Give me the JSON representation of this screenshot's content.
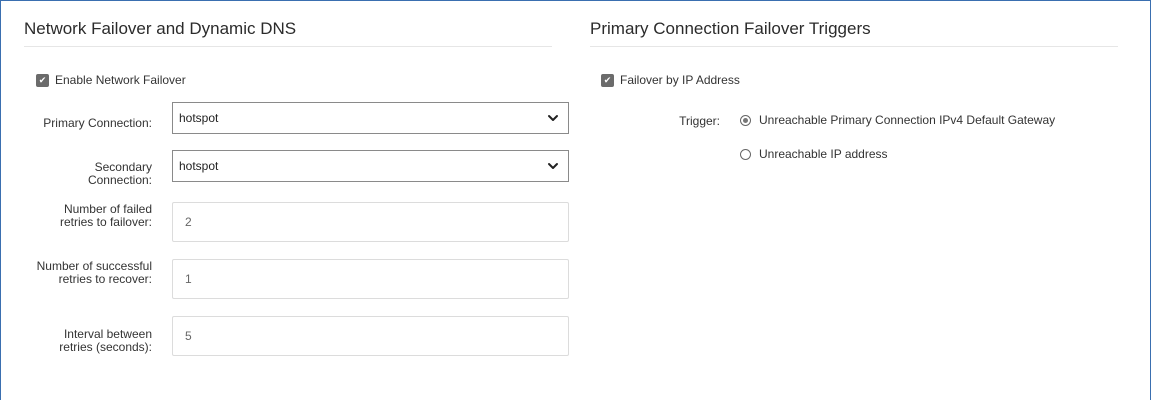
{
  "left_section": {
    "title": "Network Failover and Dynamic DNS",
    "enable_failover": {
      "label": "Enable Network Failover",
      "checked": true
    },
    "primary_connection": {
      "label": "Primary Connection:",
      "value": "hotspot"
    },
    "secondary_connection": {
      "label_line1": "Secondary",
      "label_line2": "Connection:",
      "value": "hotspot"
    },
    "failed_retries": {
      "label_line1": "Number of failed",
      "label_line2": "retries to failover:",
      "value": "2"
    },
    "successful_retries": {
      "label_line1": "Number of successful",
      "label_line2": "retries to recover:",
      "value": "1"
    },
    "interval": {
      "label_line1": "Interval between",
      "label_line2": "retries (seconds):",
      "value": "5"
    }
  },
  "right_section": {
    "title": "Primary Connection Failover Triggers",
    "failover_by_ip": {
      "label": "Failover by IP Address",
      "checked": true
    },
    "trigger": {
      "label": "Trigger:",
      "options": [
        {
          "label": "Unreachable Primary Connection IPv4 Default Gateway",
          "selected": true
        },
        {
          "label": "Unreachable IP address",
          "selected": false
        }
      ]
    }
  },
  "icons": {
    "checkbox_checked": "checkbox-checked-icon",
    "dropdown": "chevron-down-icon"
  },
  "colors": {
    "frame_border": "#3a6fb0",
    "field_border": "#8a8a8a",
    "checkbox_fill": "#6b6b6b"
  }
}
